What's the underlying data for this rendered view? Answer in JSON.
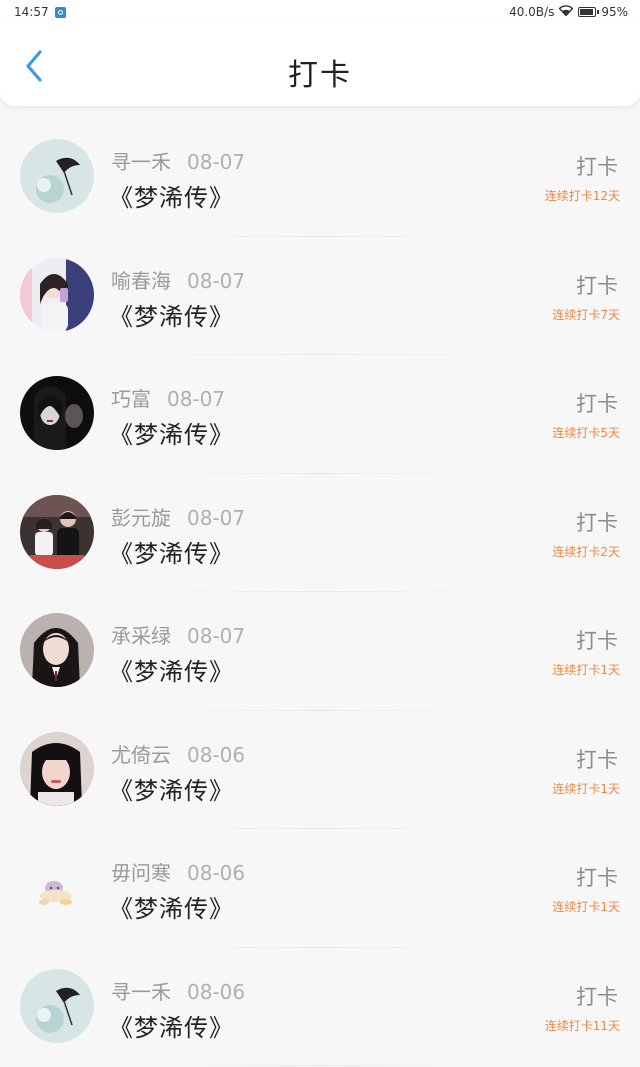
{
  "status": {
    "time": "14:57",
    "network_speed": "40.0B/s",
    "battery": "95%"
  },
  "header": {
    "title": "打卡"
  },
  "checkins": [
    {
      "name": "寻一禾",
      "date": "08-07",
      "book": "《梦浠传》",
      "action": "打卡",
      "streak": "连续打卡12天"
    },
    {
      "name": "喻春海",
      "date": "08-07",
      "book": "《梦浠传》",
      "action": "打卡",
      "streak": "连续打卡7天"
    },
    {
      "name": "巧富",
      "date": "08-07",
      "book": "《梦浠传》",
      "action": "打卡",
      "streak": "连续打卡5天"
    },
    {
      "name": "彭元旋",
      "date": "08-07",
      "book": "《梦浠传》",
      "action": "打卡",
      "streak": "连续打卡2天"
    },
    {
      "name": "承采绿",
      "date": "08-07",
      "book": "《梦浠传》",
      "action": "打卡",
      "streak": "连续打卡1天"
    },
    {
      "name": "尤倚云",
      "date": "08-06",
      "book": "《梦浠传》",
      "action": "打卡",
      "streak": "连续打卡1天"
    },
    {
      "name": "毋问寒",
      "date": "08-06",
      "book": "《梦浠传》",
      "action": "打卡",
      "streak": "连续打卡1天"
    },
    {
      "name": "寻一禾",
      "date": "08-06",
      "book": "《梦浠传》",
      "action": "打卡",
      "streak": "连续打卡11天"
    }
  ],
  "colors": {
    "accent": "#3d9be0",
    "streak": "#ee8844"
  }
}
